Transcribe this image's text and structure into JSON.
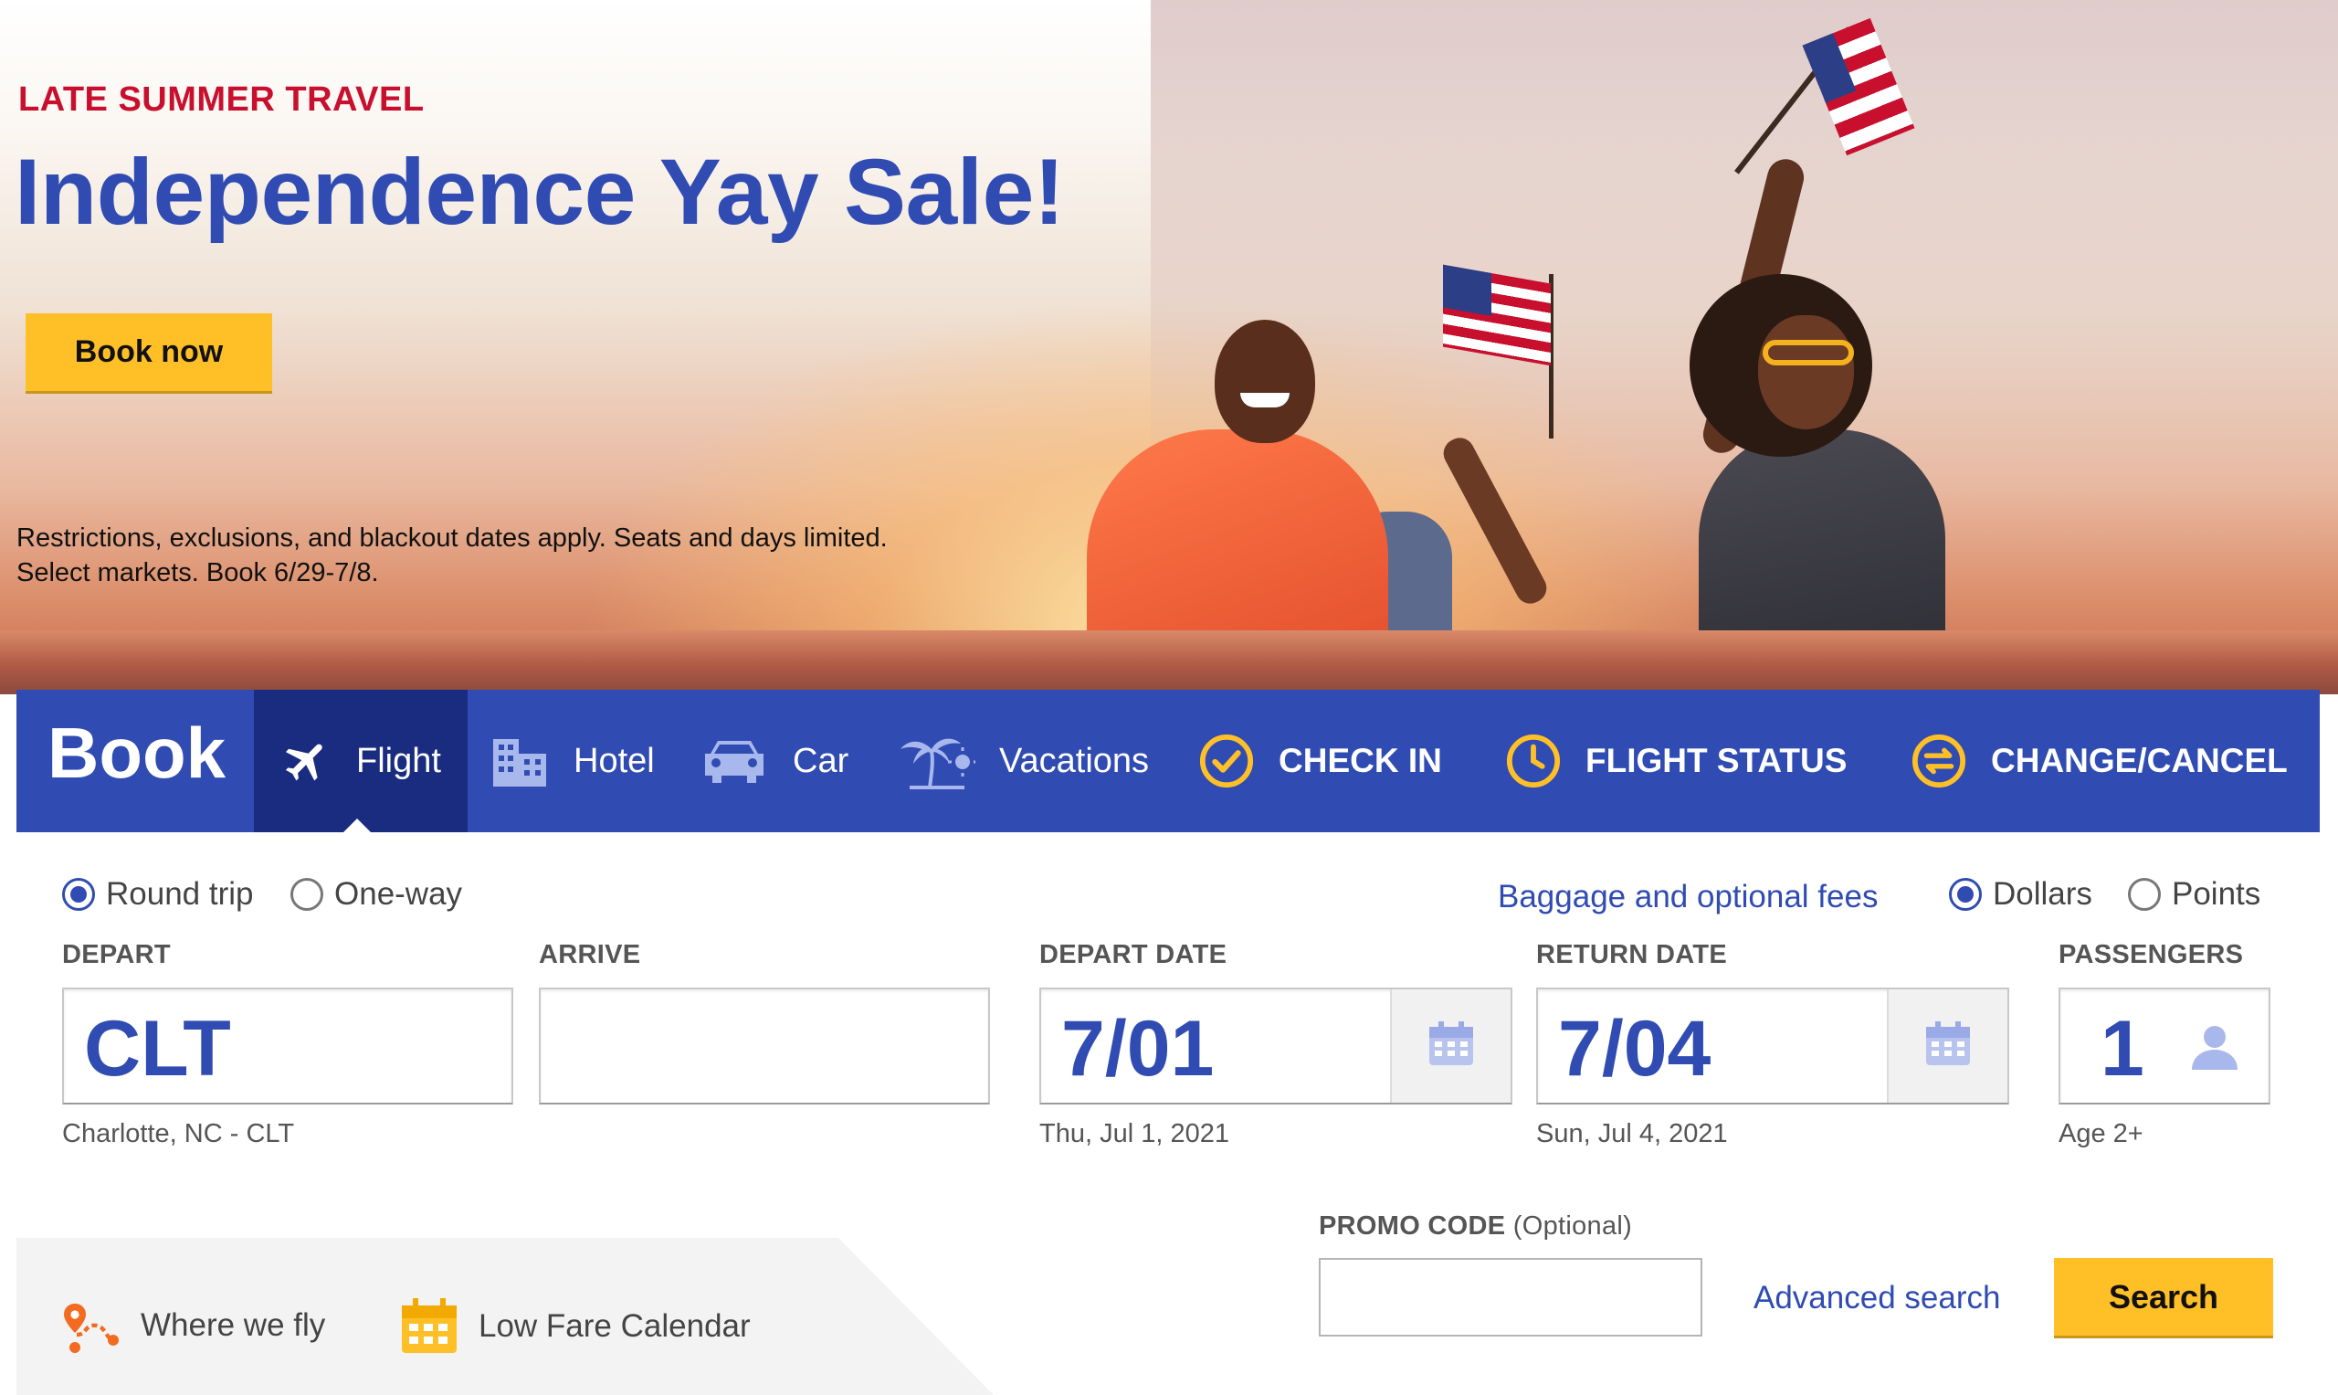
{
  "hero": {
    "eyebrow": "LATE SUMMER TRAVEL",
    "title": "Independence Yay Sale!",
    "cta_label": "Book now",
    "fine_print_line1": "Restrictions, exclusions, and blackout dates apply. Seats and days limited.",
    "fine_print_line2": "Select markets. Book 6/29-7/8."
  },
  "booking_bar": {
    "title": "Book",
    "tabs": [
      {
        "label": "Flight",
        "icon": "airplane-icon",
        "active": true
      },
      {
        "label": "Hotel",
        "icon": "hotel-icon",
        "active": false
      },
      {
        "label": "Car",
        "icon": "car-icon",
        "active": false
      },
      {
        "label": "Vacations",
        "icon": "palm-tree-icon",
        "active": false
      }
    ],
    "actions": [
      {
        "label": "CHECK IN",
        "icon": "check-circle-icon"
      },
      {
        "label": "FLIGHT STATUS",
        "icon": "clock-icon"
      },
      {
        "label": "CHANGE/CANCEL",
        "icon": "swap-arrows-icon"
      }
    ]
  },
  "form": {
    "trip_type": {
      "options": [
        "Round trip",
        "One-way"
      ],
      "selected": "Round trip"
    },
    "baggage_link": "Baggage and optional fees",
    "currency": {
      "options": [
        "Dollars",
        "Points"
      ],
      "selected": "Dollars"
    },
    "depart": {
      "label": "DEPART",
      "value": "CLT",
      "detail": "Charlotte, NC - CLT"
    },
    "arrive": {
      "label": "ARRIVE",
      "value": "",
      "detail": ""
    },
    "depart_date": {
      "label": "DEPART DATE",
      "value": "7/01",
      "detail": "Thu, Jul 1, 2021"
    },
    "return_date": {
      "label": "RETURN DATE",
      "value": "7/04",
      "detail": "Sun, Jul 4, 2021"
    },
    "passengers": {
      "label": "PASSENGERS",
      "value": "1",
      "detail": "Age 2+"
    },
    "promo": {
      "label": "PROMO CODE",
      "optional": "(Optional)",
      "value": ""
    },
    "advanced_search": "Advanced search",
    "search_label": "Search"
  },
  "tools": [
    {
      "label": "Where we fly",
      "icon": "route-map-icon"
    },
    {
      "label": "Low Fare Calendar",
      "icon": "calendar-icon"
    }
  ],
  "colors": {
    "brand_blue": "#304cb2",
    "brand_dark_blue": "#1a2c80",
    "accent_yellow": "#ffbf27",
    "accent_red": "#c8102e"
  }
}
